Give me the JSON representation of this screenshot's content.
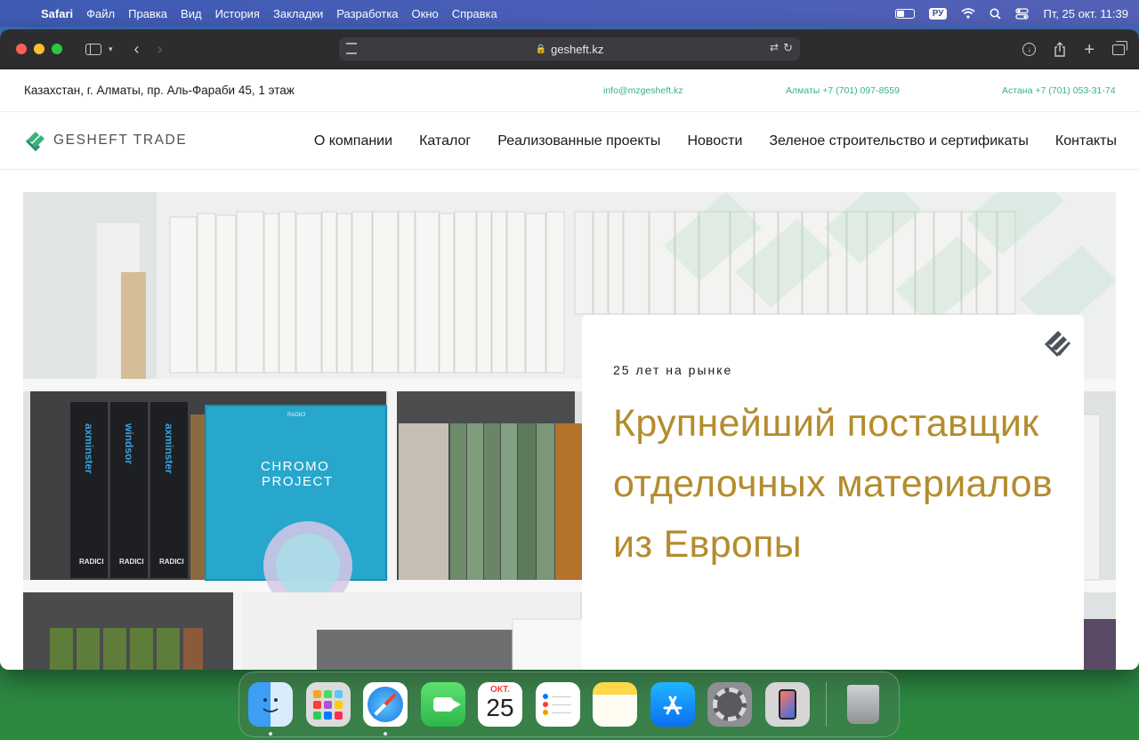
{
  "menubar": {
    "app_name": "Safari",
    "items": [
      "Файл",
      "Правка",
      "Вид",
      "История",
      "Закладки",
      "Разработка",
      "Окно",
      "Справка"
    ],
    "input_source": "РУ",
    "datetime": "Пт, 25 окт.  11:39"
  },
  "browser": {
    "url": "gesheft.kz"
  },
  "site": {
    "topbar": {
      "address": "Казахстан, г. Алматы, пр. Аль-Фараби 45, 1 этаж",
      "email": "info@mzgesheft.kz",
      "phone_almaty": "Алматы +7 (701) 097-8559",
      "phone_astana": "Астана +7 (701) 053-31-74"
    },
    "logo_text": "GESHEFT TRADE",
    "nav": [
      "О компании",
      "Каталог",
      "Реализованные проекты",
      "Новости",
      "Зеленое строительство и сертификаты",
      "Контакты"
    ],
    "hero": {
      "kicker": "25 лет на рынке",
      "headline": "Крупнейший поставщик отделочных материалов из Европы",
      "photo_labels": {
        "binder1": "axminster",
        "binder2": "windsor",
        "binder3": "axminster",
        "binder_brand": "RADICI",
        "book_brand": "RADICI",
        "book_title_1": "CHROMO",
        "book_title_2": "PROJECT"
      }
    },
    "colors": {
      "accent_green": "#37b37e",
      "headline_gold": "#b48c2d"
    }
  },
  "dock": {
    "apps": [
      "finder-icon",
      "launchpad-icon",
      "safari-icon",
      "facetime-icon",
      "calendar-icon",
      "reminders-icon",
      "notes-icon",
      "app-store-icon",
      "system-settings-icon",
      "iphone-mirroring-icon",
      "trash-icon"
    ],
    "calendar_month": "ОКТ.",
    "calendar_day": "25"
  }
}
